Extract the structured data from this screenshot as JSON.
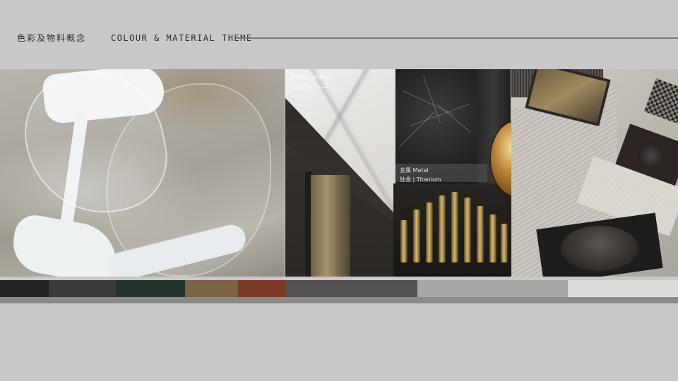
{
  "header": {
    "title_zh": "色彩及物料概念",
    "title_en": "COLOUR & MATERIAL THEME"
  },
  "captions": {
    "marble_line1": "大理石 | Marble",
    "marble_line2": "大理石纹",
    "metal_line1": "金属  Metal",
    "metal_line2": "钛金 | Titanium"
  },
  "palette": [
    {
      "name": "charcoal",
      "color": "#232223",
      "weight": 69
    },
    {
      "name": "graphite",
      "color": "#3b3a3c",
      "weight": 95
    },
    {
      "name": "forest-green",
      "color": "#25342a",
      "weight": 98
    },
    {
      "name": "bronze",
      "color": "#7c6448",
      "weight": 75
    },
    {
      "name": "rust",
      "color": "#7a3a26",
      "weight": 67
    },
    {
      "name": "warm-grey",
      "color": "#545150",
      "weight": 187
    },
    {
      "name": "light-grey",
      "color": "#a8a6a4",
      "weight": 213
    },
    {
      "name": "off-white",
      "color": "#dedcd8",
      "weight": 156
    }
  ]
}
